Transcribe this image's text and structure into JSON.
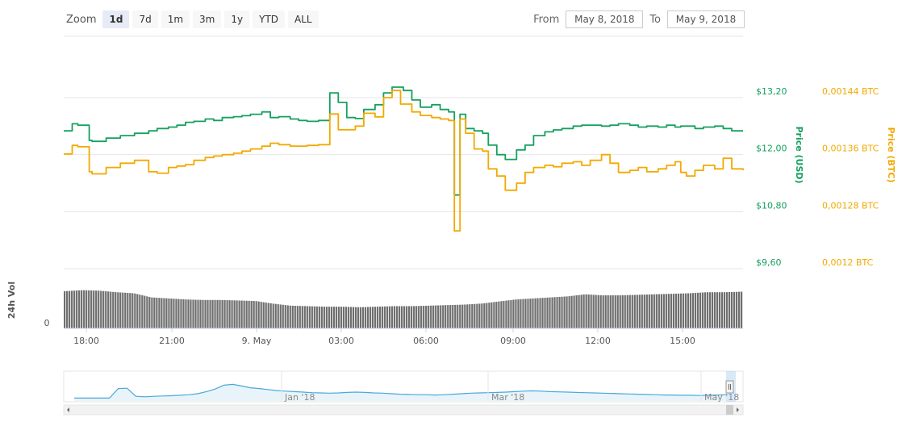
{
  "zoom": {
    "label": "Zoom",
    "buttons": [
      "1d",
      "7d",
      "1m",
      "3m",
      "1y",
      "YTD",
      "ALL"
    ],
    "active": "1d"
  },
  "range": {
    "from_label": "From",
    "from_value": "May 8, 2018",
    "to_label": "To",
    "to_value": "May 9, 2018"
  },
  "colors": {
    "usd": "#16a05e",
    "btc": "#f2a900",
    "volume": "#6e6e6e",
    "navigator": "#4aa8d8",
    "grid": "#e6e6e6"
  },
  "chart_data": {
    "type": "line",
    "x_ticks": [
      "18:00",
      "21:00",
      "9. May",
      "03:00",
      "06:00",
      "09:00",
      "12:00",
      "15:00"
    ],
    "y_left": {
      "label": "Price (USD)",
      "ticks": [
        "$13,20",
        "$12,00",
        "$10,80",
        "$9,60"
      ],
      "range": [
        9.6,
        13.2
      ]
    },
    "y_right": {
      "label": "Price (BTC)",
      "ticks": [
        "0,00144 BTC",
        "0,00136 BTC",
        "0,00128 BTC",
        "0,0012 BTC"
      ],
      "range": [
        0.0012,
        0.00144
      ]
    },
    "volume": {
      "label": "24h Vol",
      "zero_label": "0",
      "relative_range": [
        0,
        1
      ],
      "relative_values": [
        0.72,
        0.74,
        0.73,
        0.7,
        0.68,
        0.6,
        0.58,
        0.56,
        0.55,
        0.55,
        0.54,
        0.53,
        0.48,
        0.44,
        0.43,
        0.42,
        0.42,
        0.41,
        0.42,
        0.43,
        0.43,
        0.44,
        0.45,
        0.46,
        0.48,
        0.52,
        0.56,
        0.58,
        0.6,
        0.62,
        0.66,
        0.64,
        0.64,
        0.65,
        0.66,
        0.67,
        0.68,
        0.7,
        0.7,
        0.71
      ]
    },
    "series": [
      {
        "name": "Price (USD)",
        "axis": "left",
        "x": [
          0,
          0.3,
          0.5,
          0.9,
          1.0,
          1.5,
          2.0,
          2.5,
          3.0,
          3.3,
          3.7,
          4.0,
          4.3,
          4.6,
          5.0,
          5.3,
          5.6,
          6.0,
          6.3,
          6.6,
          7.0,
          7.3,
          7.6,
          8.0,
          8.3,
          8.6,
          9.0,
          9.4,
          9.7,
          10.0,
          10.3,
          10.6,
          11.0,
          11.3,
          11.6,
          12.0,
          12.3,
          12.6,
          13.0,
          13.3,
          13.6,
          13.8,
          14.0,
          14.2,
          14.5,
          14.8,
          15.0,
          15.3,
          15.6,
          16.0,
          16.3,
          16.6,
          17.0,
          17.3,
          17.6,
          18.0,
          18.3,
          18.6,
          19.0,
          19.3,
          19.6,
          20.0,
          20.3,
          20.6,
          21.0,
          21.3,
          21.6,
          21.8,
          22.0,
          22.3,
          22.6,
          23.0,
          23.3,
          23.6,
          24.0
        ],
        "y": [
          12.5,
          12.65,
          12.62,
          12.3,
          12.28,
          12.35,
          12.4,
          12.45,
          12.5,
          12.55,
          12.58,
          12.62,
          12.68,
          12.7,
          12.75,
          12.72,
          12.78,
          12.8,
          12.82,
          12.85,
          12.9,
          12.78,
          12.8,
          12.75,
          12.72,
          12.7,
          12.72,
          13.3,
          13.1,
          12.78,
          12.76,
          12.95,
          13.05,
          13.3,
          13.42,
          13.35,
          13.15,
          13.0,
          13.05,
          12.95,
          12.9,
          11.15,
          12.85,
          12.55,
          12.5,
          12.45,
          12.2,
          12.0,
          11.9,
          12.1,
          12.2,
          12.4,
          12.48,
          12.52,
          12.55,
          12.6,
          12.62,
          12.62,
          12.6,
          12.62,
          12.65,
          12.62,
          12.58,
          12.6,
          12.58,
          12.62,
          12.58,
          12.6,
          12.6,
          12.55,
          12.58,
          12.6,
          12.55,
          12.5,
          12.5
        ]
      },
      {
        "name": "Price (BTC)",
        "axis": "right",
        "x": [
          0,
          0.3,
          0.5,
          0.9,
          1.0,
          1.5,
          2.0,
          2.5,
          3.0,
          3.3,
          3.7,
          4.0,
          4.3,
          4.6,
          5.0,
          5.3,
          5.6,
          6.0,
          6.3,
          6.6,
          7.0,
          7.3,
          7.6,
          8.0,
          8.3,
          8.6,
          9.0,
          9.4,
          9.7,
          10.0,
          10.3,
          10.6,
          11.0,
          11.3,
          11.6,
          11.9,
          12.3,
          12.6,
          13.0,
          13.3,
          13.6,
          13.8,
          14.0,
          14.2,
          14.5,
          14.8,
          15.0,
          15.3,
          15.6,
          16.0,
          16.3,
          16.6,
          17.0,
          17.3,
          17.6,
          18.0,
          18.3,
          18.6,
          19.0,
          19.3,
          19.6,
          20.0,
          20.3,
          20.6,
          21.0,
          21.3,
          21.6,
          21.8,
          22.0,
          22.3,
          22.6,
          23.0,
          23.3,
          23.6,
          24.0
        ],
        "y": [
          0.001361,
          0.001373,
          0.001371,
          0.001336,
          0.001333,
          0.001342,
          0.001348,
          0.001352,
          0.001336,
          0.001334,
          0.001342,
          0.001344,
          0.001346,
          0.001352,
          0.001356,
          0.001358,
          0.00136,
          0.001362,
          0.001365,
          0.001368,
          0.001372,
          0.001376,
          0.001374,
          0.001372,
          0.001372,
          0.001373,
          0.001374,
          0.001417,
          0.001395,
          0.001395,
          0.0014,
          0.001418,
          0.001413,
          0.00144,
          0.00145,
          0.001431,
          0.00142,
          0.001415,
          0.001412,
          0.00141,
          0.001408,
          0.001253,
          0.00141,
          0.00139,
          0.001368,
          0.001365,
          0.00134,
          0.00133,
          0.00131,
          0.00132,
          0.001335,
          0.001342,
          0.001345,
          0.001343,
          0.001348,
          0.00135,
          0.001345,
          0.001352,
          0.00136,
          0.001348,
          0.001335,
          0.001338,
          0.001342,
          0.001336,
          0.00134,
          0.001345,
          0.00135,
          0.001335,
          0.00133,
          0.001338,
          0.001345,
          0.00134,
          0.001355,
          0.00134,
          0.001338
        ]
      }
    ],
    "navigator": {
      "labels": [
        "Jan '18",
        "Mar '18",
        "May '18"
      ],
      "relative_range": [
        0,
        1
      ],
      "relative_values": [
        0.05,
        0.05,
        0.05,
        0.05,
        0.05,
        0.42,
        0.43,
        0.12,
        0.1,
        0.12,
        0.13,
        0.14,
        0.16,
        0.18,
        0.22,
        0.3,
        0.4,
        0.55,
        0.58,
        0.52,
        0.45,
        0.42,
        0.38,
        0.34,
        0.32,
        0.3,
        0.28,
        0.26,
        0.25,
        0.24,
        0.25,
        0.27,
        0.28,
        0.27,
        0.25,
        0.24,
        0.22,
        0.2,
        0.19,
        0.18,
        0.18,
        0.17,
        0.18,
        0.2,
        0.22,
        0.24,
        0.25,
        0.26,
        0.27,
        0.28,
        0.3,
        0.32,
        0.33,
        0.32,
        0.3,
        0.29,
        0.28,
        0.27,
        0.26,
        0.25,
        0.24,
        0.23,
        0.22,
        0.21,
        0.2,
        0.19,
        0.18,
        0.17,
        0.17,
        0.16,
        0.16,
        0.15,
        0.16,
        0.17,
        0.18
      ]
    }
  }
}
